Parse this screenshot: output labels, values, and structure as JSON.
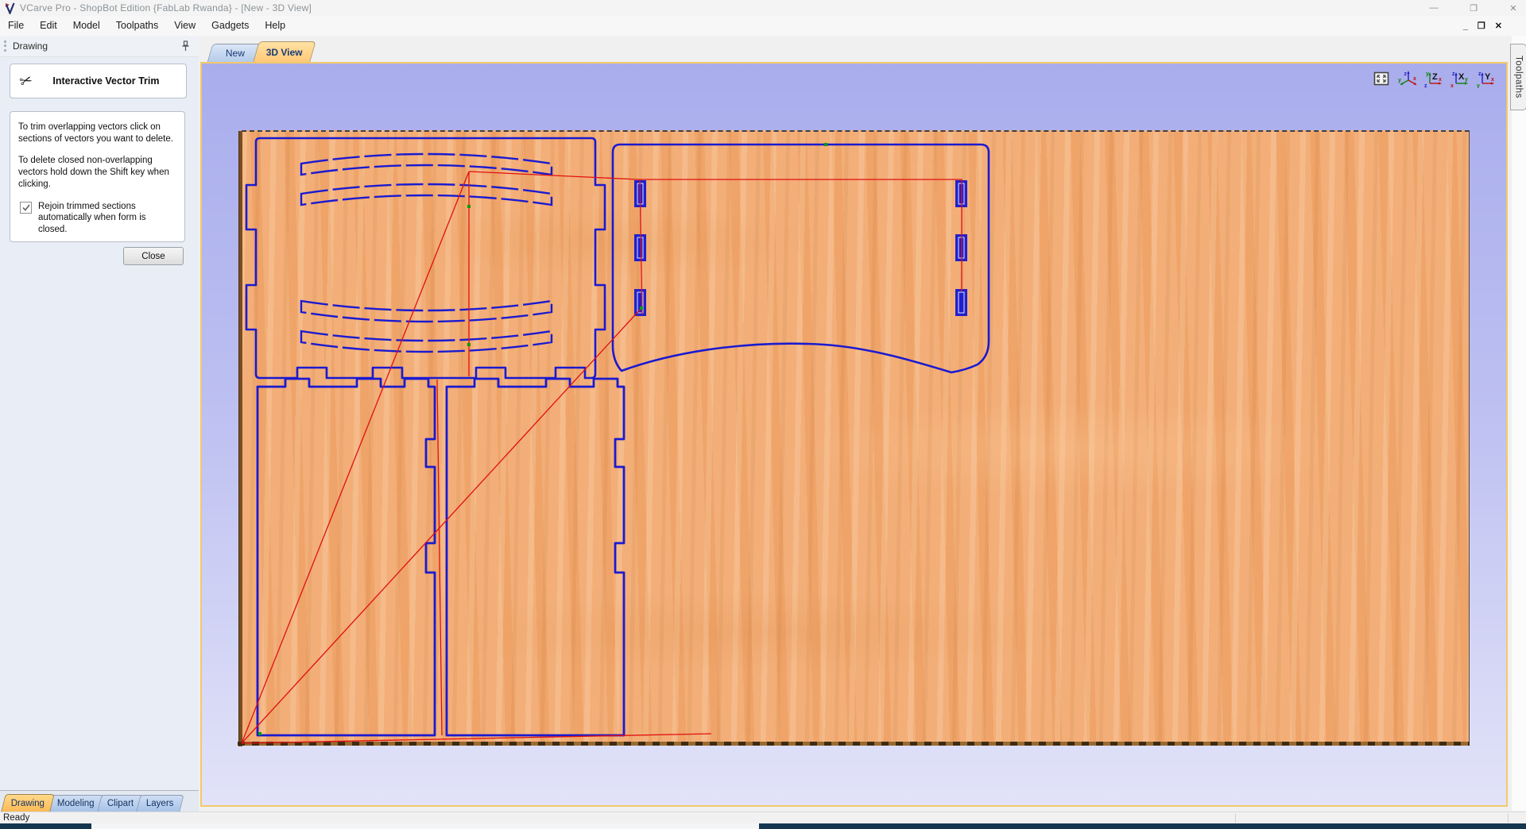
{
  "window": {
    "title": "VCarve Pro - ShopBot Edition {FabLab Rwanda} - [New - 3D View]",
    "controls": {
      "minimize": "—",
      "restore": "❐",
      "close": "✕"
    },
    "doc_controls": {
      "minimize": "_",
      "restore": "❐",
      "close": "✕"
    }
  },
  "menu": {
    "items": [
      "File",
      "Edit",
      "Model",
      "Toolpaths",
      "View",
      "Gadgets",
      "Help"
    ]
  },
  "left_panel": {
    "header": "Drawing",
    "tool_title": "Interactive Vector Trim",
    "scissors_icon": "✂",
    "para1": "To trim overlapping vectors click on sections of vectors you want to delete.",
    "para2": "To delete closed non-overlapping vectors hold down the Shift key when clicking.",
    "checkbox_label": "Rejoin trimmed sections automatically when form is closed.",
    "checkbox_checked": true,
    "close_button": "Close"
  },
  "doc_tabs": [
    {
      "label": "New",
      "active": false
    },
    {
      "label": "3D View",
      "active": true
    }
  ],
  "right_panel_tab": "Toolpaths",
  "bottom_tabs": [
    {
      "label": "Drawing",
      "active": true
    },
    {
      "label": "Modeling",
      "active": false
    },
    {
      "label": "Clipart",
      "active": false
    },
    {
      "label": "Layers",
      "active": false
    }
  ],
  "view_buttons": {
    "iso": {
      "up": "z",
      "left": "y",
      "right": "x"
    },
    "top": {
      "letter": "Z",
      "up": "y",
      "right": "x",
      "origin": "z"
    },
    "front": {
      "letter": "X",
      "up": "z",
      "right": "y",
      "origin": "x"
    },
    "side": {
      "letter": "Y",
      "up": "z",
      "right": "x",
      "origin": "y"
    }
  },
  "status": {
    "ready": "Ready"
  },
  "colors": {
    "accent_gold": "#f3c96a",
    "canvas_lavender_top": "#a9adec",
    "canvas_lavender_bottom": "#e2e3f8",
    "wood": "#f2a76d",
    "vector_blue": "#1a1ad0",
    "guide_red": "#e01010",
    "node_green": "#00a000",
    "taskbar_navy": "#15364f",
    "active_tab_orange": "#ffc978",
    "inactive_tab_blue": "#b4cbea"
  }
}
